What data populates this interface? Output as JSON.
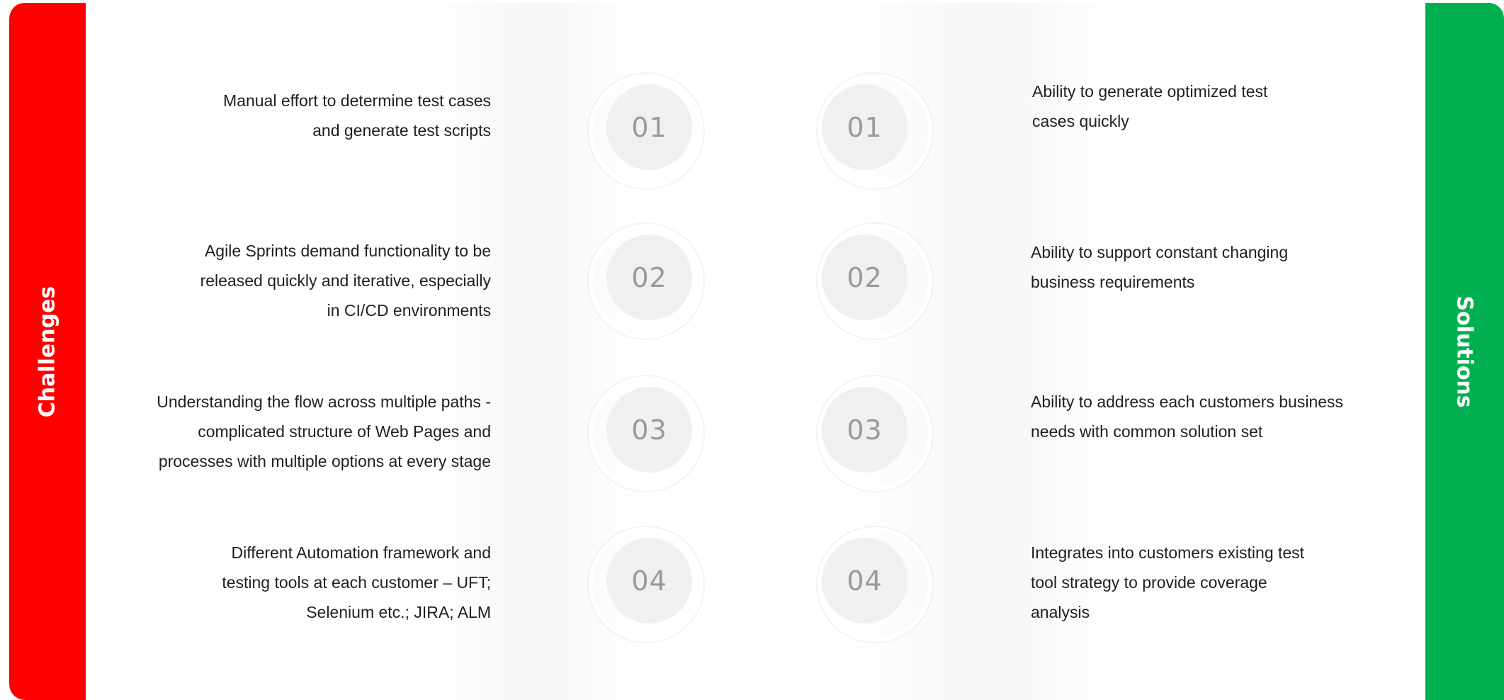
{
  "left_header": "Challenges",
  "right_header": "Solutions",
  "challenges": [
    {
      "number": "01",
      "lines": [
        "Manual effort to determine test cases",
        "and generate test scripts"
      ]
    },
    {
      "number": "02",
      "lines": [
        "Agile Sprints demand functionality to be",
        "released quickly and iterative,  especially",
        "in CI/CD environments"
      ]
    },
    {
      "number": "03",
      "lines": [
        "Understanding the flow across multiple paths -",
        "complicated structure of Web Pages and",
        "processes with multiple options at every stage"
      ]
    },
    {
      "number": "04",
      "lines": [
        "Different Automation framework and",
        "testing tools at each customer – UFT;",
        "Selenium etc.; JIRA; ALM"
      ]
    }
  ],
  "solutions": [
    {
      "number": "01",
      "lines": [
        "Ability to generate optimized test",
        "cases quickly"
      ]
    },
    {
      "number": "02",
      "lines": [
        "Ability to support constant changing",
        "business requirements"
      ]
    },
    {
      "number": "03",
      "lines": [
        "Ability to address each customers business",
        "needs with common solution set"
      ]
    },
    {
      "number": "04",
      "lines": [
        "Integrates into customers existing test",
        "tool strategy to provide coverage",
        "analysis"
      ]
    }
  ],
  "colors": {
    "challenges_band": "#ff0000",
    "solutions_band": "#00b050",
    "number_circle": "#f0f0f0",
    "number_text": "#9a9a9a"
  }
}
